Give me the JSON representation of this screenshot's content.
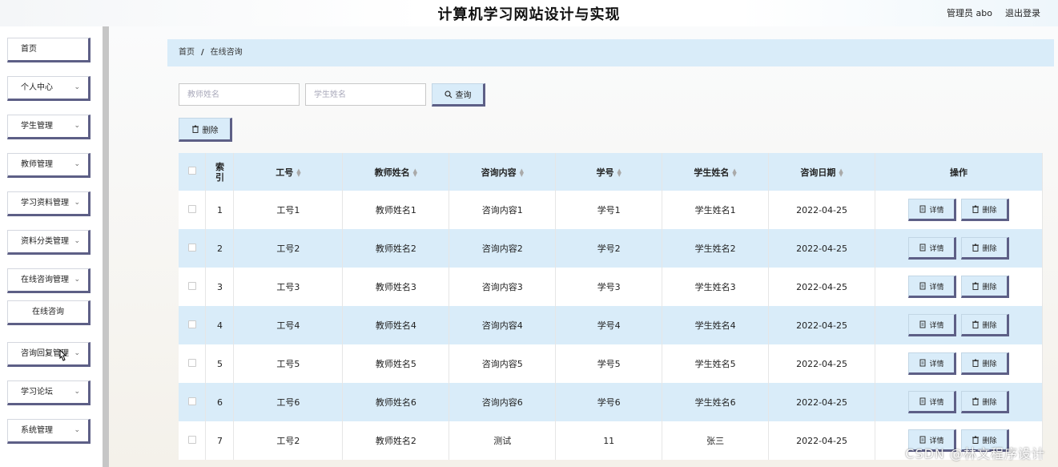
{
  "header": {
    "title": "计算机学习网站设计与实现",
    "user": "管理员 abo",
    "logout": "退出登录"
  },
  "sidebar": {
    "items": [
      {
        "label": "首页",
        "chevron": false
      },
      {
        "label": "个人中心",
        "chevron": true
      },
      {
        "label": "学生管理",
        "chevron": true
      },
      {
        "label": "教师管理",
        "chevron": true
      },
      {
        "label": "学习资料管理",
        "chevron": true
      },
      {
        "label": "资料分类管理",
        "chevron": true
      },
      {
        "label": "在线咨询管理",
        "chevron": true
      },
      {
        "label": "在线咨询",
        "chevron": false
      },
      {
        "label": "咨询回复管理",
        "chevron": true
      },
      {
        "label": "学习论坛",
        "chevron": true
      },
      {
        "label": "系统管理",
        "chevron": true
      }
    ]
  },
  "breadcrumb": {
    "home": "首页",
    "sep": "/",
    "current": "在线咨询"
  },
  "search": {
    "teacher_placeholder": "教师姓名",
    "student_placeholder": "学生姓名",
    "query_label": "查询"
  },
  "toolbar": {
    "delete_label": "删除"
  },
  "table": {
    "headers": [
      "索引",
      "工号",
      "教师姓名",
      "咨询内容",
      "学号",
      "学生姓名",
      "咨询日期",
      "操作"
    ],
    "rows": [
      [
        "1",
        "工号1",
        "教师姓名1",
        "咨询内容1",
        "学号1",
        "学生姓名1",
        "2022-04-25"
      ],
      [
        "2",
        "工号2",
        "教师姓名2",
        "咨询内容2",
        "学号2",
        "学生姓名2",
        "2022-04-25"
      ],
      [
        "3",
        "工号3",
        "教师姓名3",
        "咨询内容3",
        "学号3",
        "学生姓名3",
        "2022-04-25"
      ],
      [
        "4",
        "工号4",
        "教师姓名4",
        "咨询内容4",
        "学号4",
        "学生姓名4",
        "2022-04-25"
      ],
      [
        "5",
        "工号5",
        "教师姓名5",
        "咨询内容5",
        "学号5",
        "学生姓名5",
        "2022-04-25"
      ],
      [
        "6",
        "工号6",
        "教师姓名6",
        "咨询内容6",
        "学号6",
        "学生姓名6",
        "2022-04-25"
      ],
      [
        "7",
        "工号2",
        "教师姓名2",
        "测试",
        "11",
        "张三",
        "2022-04-25"
      ]
    ],
    "action_detail": "详情",
    "action_delete": "删除"
  },
  "watermark": "CSDN @林文程序设计",
  "colors": {
    "accent": "#d9ecf9",
    "button_border": "#5d5f86"
  }
}
